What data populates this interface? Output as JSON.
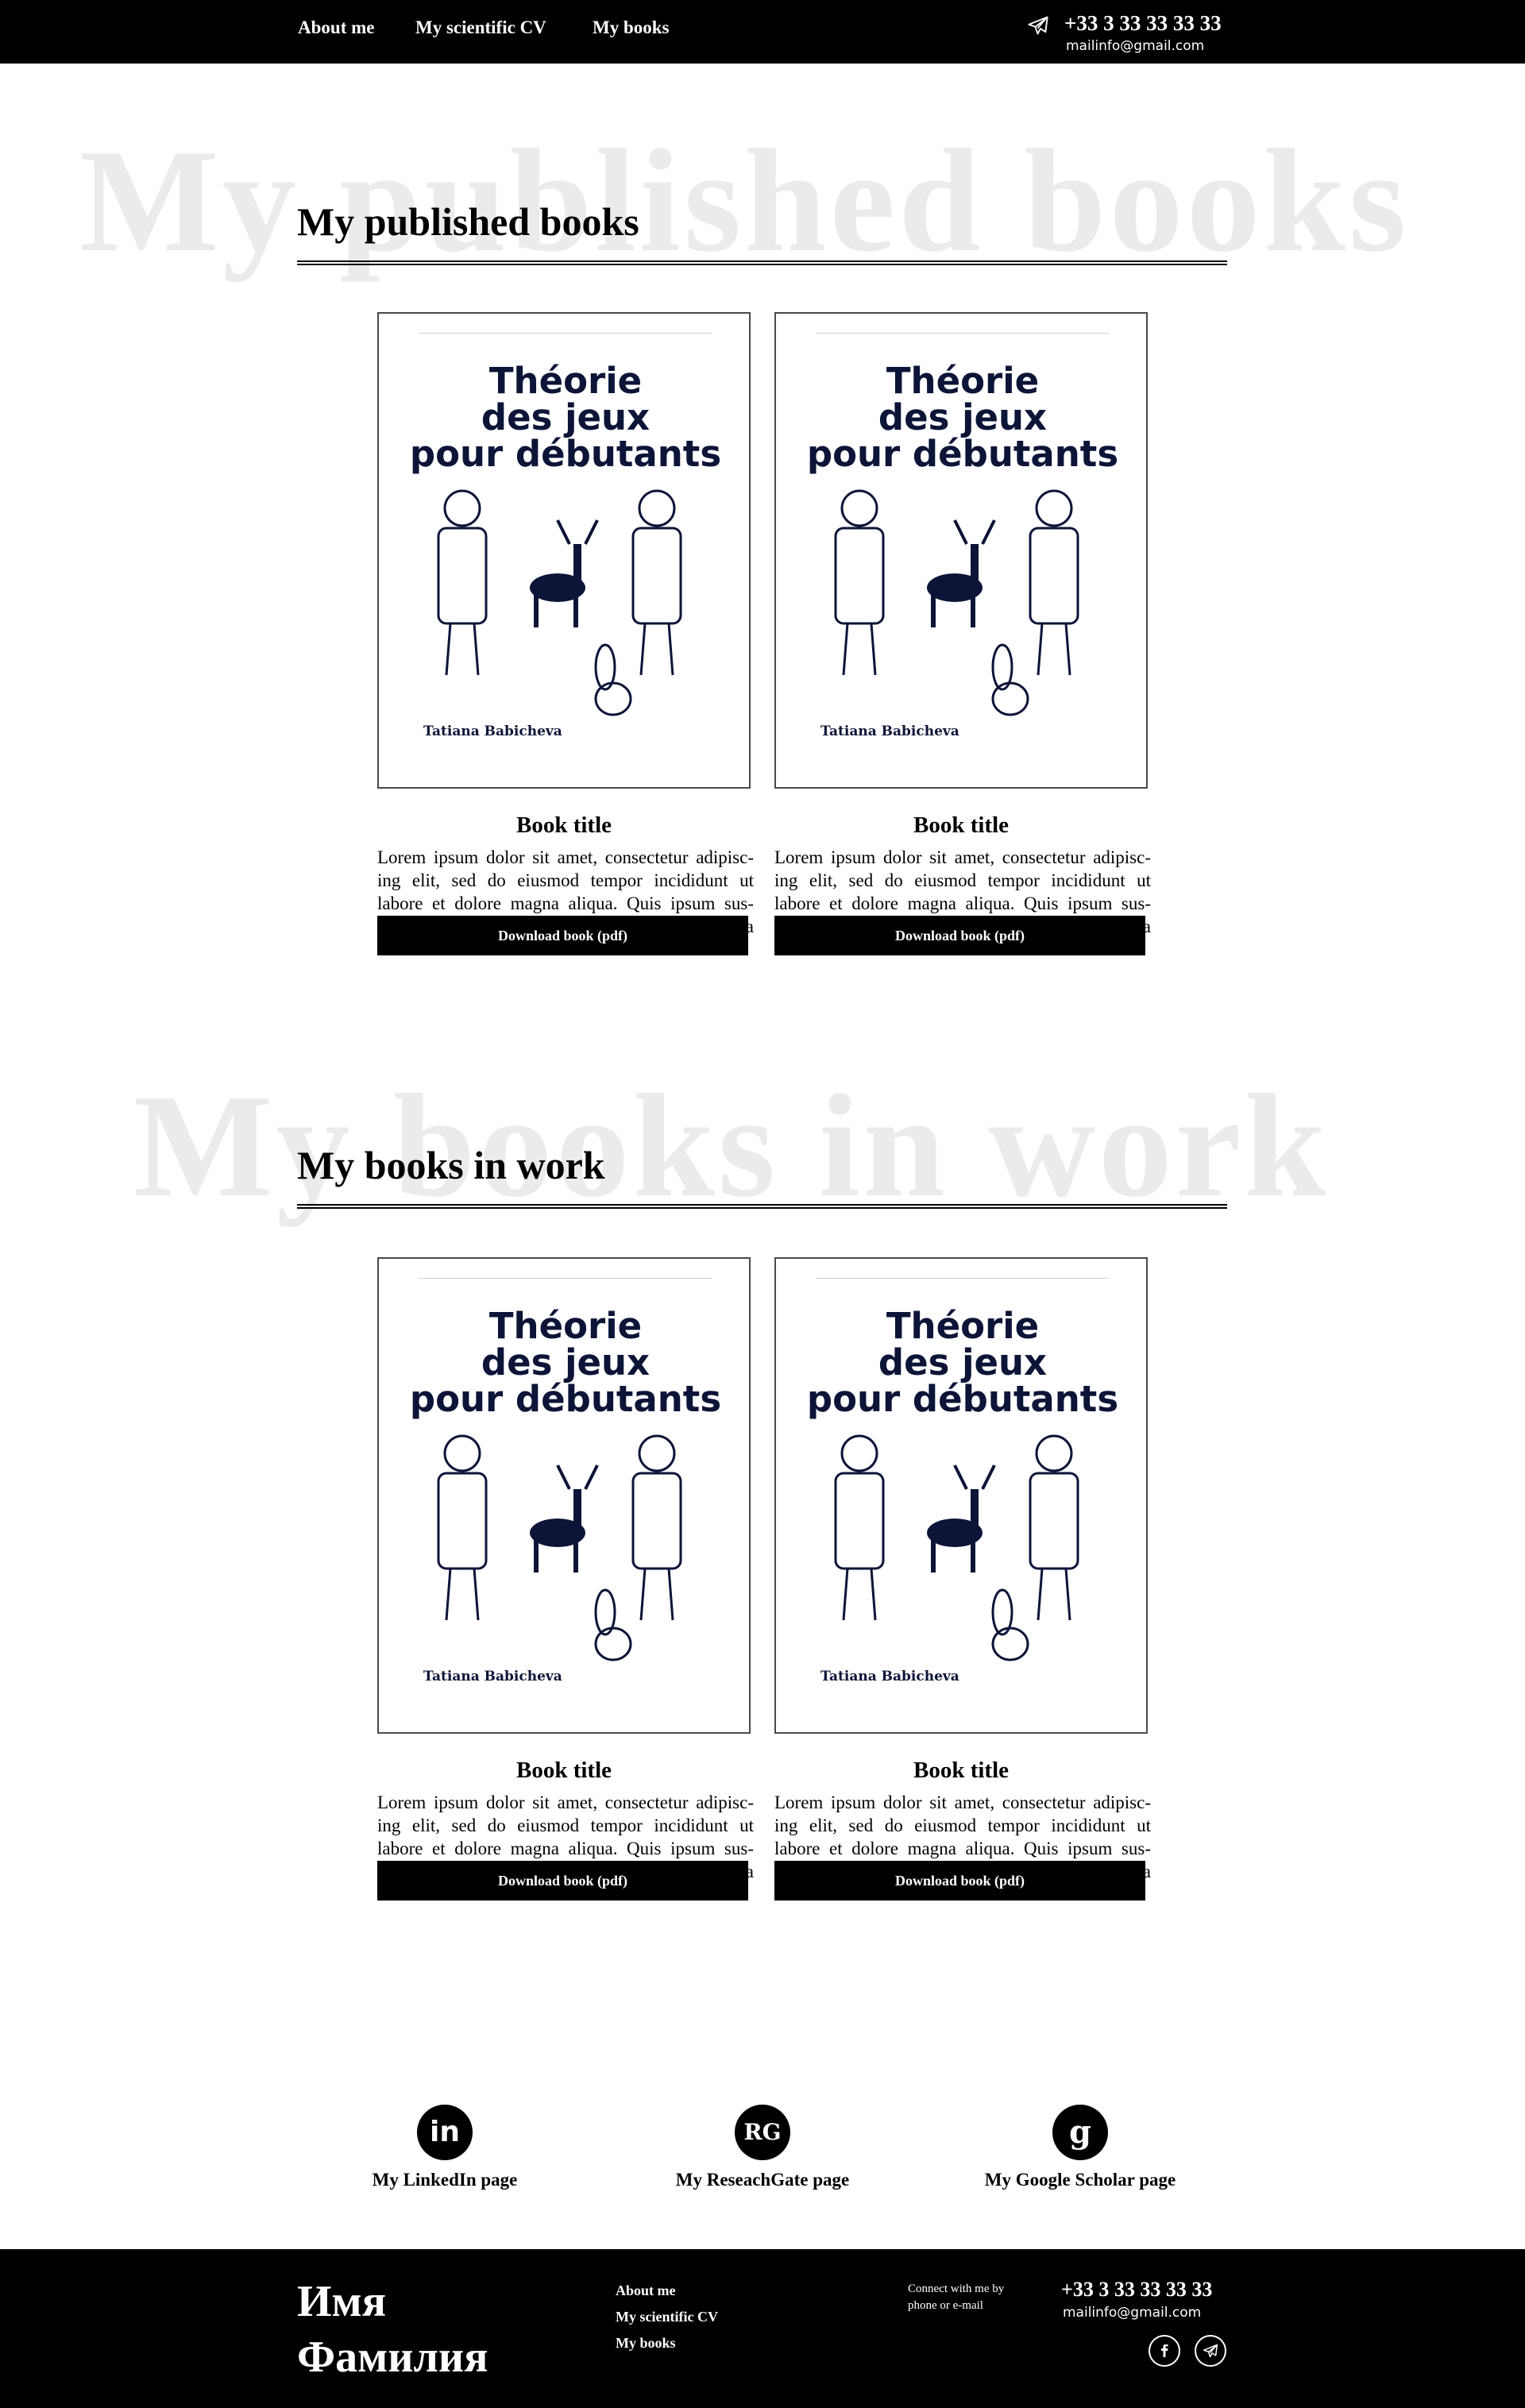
{
  "nav": {
    "items": [
      {
        "label": "About me"
      },
      {
        "label": "My scientific CV"
      },
      {
        "label": "My books"
      }
    ],
    "phone": "+33 3 33 33 33 33",
    "email": "mailinfo@gmail.com",
    "contact_icon": "telegram-plane-icon"
  },
  "sections": [
    {
      "ghost": "My published books",
      "title": "My published books",
      "books": [
        {
          "cover_title": "Théorie\ndes jeux\npour débutants",
          "cover_author": "Tatiana Babicheva",
          "title": "Book title",
          "description": "Lorem ipsum dolor sit amet, consectetur adipisc-ing elit, sed do eiusmod tempor incididunt ut labore et dolore magna aliqua. Quis ipsum sus-pendisse ultrices gravida. Risus commodo viver-ra maecenas accumsan lacus vel facilisis.",
          "button": "Download book (pdf)"
        },
        {
          "cover_title": "Théorie\ndes jeux\npour débutants",
          "cover_author": "Tatiana Babicheva",
          "title": "Book title",
          "description": "Lorem ipsum dolor sit amet, consectetur adipisc-ing elit, sed do eiusmod tempor incididunt ut labore et dolore magna aliqua. Quis ipsum sus-pendisse ultrices gravida. Risus commodo viver-ra maecenas accumsan lacus vel facilisis.",
          "button": "Download book (pdf)"
        }
      ]
    },
    {
      "ghost": "My books in work",
      "title": "My books in work",
      "books": [
        {
          "cover_title": "Théorie\ndes jeux\npour débutants",
          "cover_author": "Tatiana Babicheva",
          "title": "Book title",
          "description": "Lorem ipsum dolor sit amet, consectetur adipisc-ing elit, sed do eiusmod tempor incididunt ut labore et dolore magna aliqua. Quis ipsum sus-pendisse ultrices gravida. Risus commodo viver-ra maecenas accumsan lacus vel facilisis.",
          "button": "Download book (pdf)"
        },
        {
          "cover_title": "Théorie\ndes jeux\npour débutants",
          "cover_author": "Tatiana Babicheva",
          "title": "Book title",
          "description": "Lorem ipsum dolor sit amet, consectetur adipisc-ing elit, sed do eiusmod tempor incididunt ut labore et dolore magna aliqua. Quis ipsum sus-pendisse ultrices gravida. Risus commodo viver-ra maecenas accumsan lacus vel facilisis.",
          "button": "Download book (pdf)"
        }
      ]
    }
  ],
  "social": [
    {
      "label": "My LinkedIn page",
      "icon": "linkedin-icon",
      "glyph": "in"
    },
    {
      "label": "My ReseachGate page",
      "icon": "researchgate-icon",
      "glyph": "RG"
    },
    {
      "label": "My Google Scholar page",
      "icon": "google-scholar-icon",
      "glyph": "g"
    }
  ],
  "footer": {
    "first_name": "Имя",
    "last_name": "Фамилия",
    "links": [
      {
        "label": "About me"
      },
      {
        "label": "My scientific CV"
      },
      {
        "label": "My books"
      }
    ],
    "connect_text": "Connect with me by phone or e-mail",
    "phone": "+33 3 33 33 33 33",
    "email": "mailinfo@gmail.com",
    "icons": [
      "facebook-icon",
      "telegram-icon"
    ]
  },
  "colors": {
    "bar": "#000000",
    "ghost_text": "#ebebeb",
    "cover_ink": "#0c1438"
  }
}
